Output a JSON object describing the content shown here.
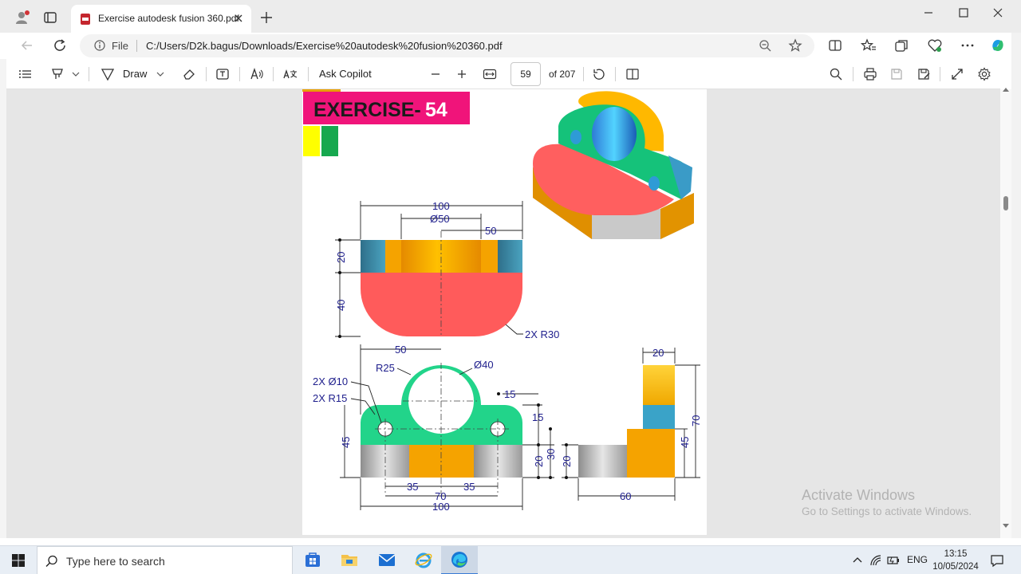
{
  "browser": {
    "tab": {
      "title": "Exercise autodesk fusion 360.pdf"
    },
    "address": {
      "scheme_label": "File",
      "url": "C:/Users/D2k.bagus/Downloads/Exercise%20autodesk%20fusion%20360.pdf"
    }
  },
  "pdf_toolbar": {
    "draw_label": "Draw",
    "ask_copilot_label": "Ask Copilot",
    "current_page": "59",
    "page_count_label": "of 207"
  },
  "drawing": {
    "title_prefix": "EXERCISE-",
    "title_number": "54",
    "front_dims": [
      "100",
      "Ø50",
      "50",
      "20",
      "40",
      "2X R30"
    ],
    "top_dims": [
      "50",
      "R25",
      "Ø40",
      "2X Ø10",
      "2X R15",
      "15",
      "15",
      "45",
      "20",
      "30",
      "35",
      "35",
      "70",
      "100"
    ],
    "side_dims": [
      "20",
      "70",
      "45",
      "20",
      "60"
    ]
  },
  "watermark": {
    "line1": "Activate Windows",
    "line2": "Go to Settings to activate Windows."
  },
  "taskbar": {
    "search_placeholder": "Type here to search",
    "language": "ENG",
    "time": "13:15",
    "date": "10/05/2024"
  }
}
